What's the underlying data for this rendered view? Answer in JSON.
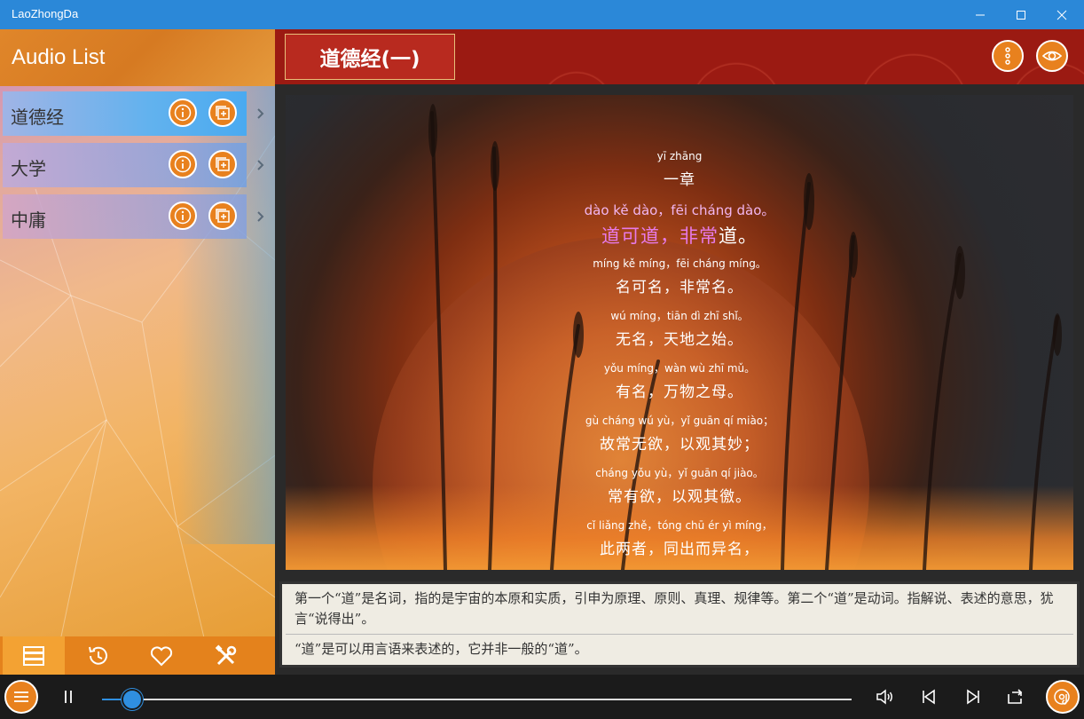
{
  "window": {
    "title": "LaoZhongDa"
  },
  "sidebar": {
    "title": "Audio List",
    "items": [
      {
        "label": "道德经"
      },
      {
        "label": "大学"
      },
      {
        "label": "中庸"
      }
    ],
    "tabs": [
      {
        "icon": "list-icon"
      },
      {
        "icon": "history-icon"
      },
      {
        "icon": "heart-icon"
      },
      {
        "icon": "tools-icon"
      }
    ]
  },
  "main": {
    "title": "道德经(一)",
    "verses": [
      {
        "pinyin": "yī zhāng",
        "hanzi": "一章"
      },
      {
        "pinyin": "dào kě dào，fēi cháng dào。",
        "hanzi_hl": "道可道，非常",
        "hanzi_rest": "道。"
      },
      {
        "pinyin": "míng kě míng，fēi cháng míng。",
        "hanzi": "名可名，非常名。"
      },
      {
        "pinyin": "wú míng，tiān dì zhī shǐ。",
        "hanzi": "无名，天地之始。"
      },
      {
        "pinyin": "yǒu míng，wàn wù zhī mǔ。",
        "hanzi": "有名，万物之母。"
      },
      {
        "pinyin": "gù cháng wú yù，yǐ guān qí miào；",
        "hanzi": "故常无欲，以观其妙；"
      },
      {
        "pinyin": "cháng yǒu yù，yǐ guān qí jiào。",
        "hanzi": "常有欲，以观其徼。"
      },
      {
        "pinyin": "cǐ liǎng zhě，tóng chū ér yì míng，",
        "hanzi": "此两者，同出而异名，"
      }
    ],
    "note_explanation": "第一个“道”是名词，指的是宇宙的本原和实质，引申为原理、原则、真理、规律等。第二个“道”是动词。指解说、表述的意思，犹言“说得出”。",
    "note_translation": "“道”是可以用言语来表述的，它并非一般的“道”。"
  },
  "player": {
    "progress": 0.04,
    "state": "playing"
  },
  "colors": {
    "accent": "#e8811e",
    "titlebar": "#2b88d8",
    "header_red": "#9b1a12",
    "highlight": "#e77ae8",
    "progress": "#2f8fe0"
  }
}
